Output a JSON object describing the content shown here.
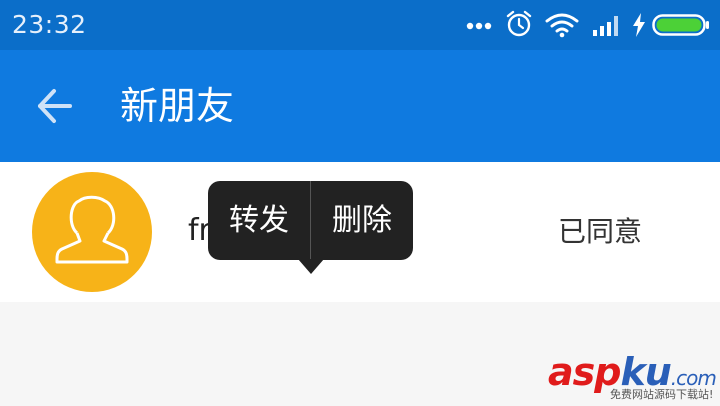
{
  "status_bar": {
    "time": "23:32",
    "icons": [
      "more-dots-icon",
      "alarm-clock-icon",
      "wifi-icon",
      "signal-icon",
      "charging-bolt-icon",
      "battery-icon"
    ],
    "battery_color": "#4cd137"
  },
  "header": {
    "title": "新朋友",
    "back_icon": "arrow-left-icon",
    "color": "#0f7ae0"
  },
  "friend_list": {
    "items": [
      {
        "name": "fr",
        "status": "已同意",
        "avatar_color": "#f7b318",
        "avatar_icon": "person-outline-icon"
      }
    ]
  },
  "context_menu": {
    "items": [
      {
        "label": "转发"
      },
      {
        "label": "删除"
      }
    ]
  },
  "watermark": {
    "brand_red": "asp",
    "brand_blue": "ku",
    "suffix": ".com",
    "tagline": "免费网站源码下载站!"
  }
}
